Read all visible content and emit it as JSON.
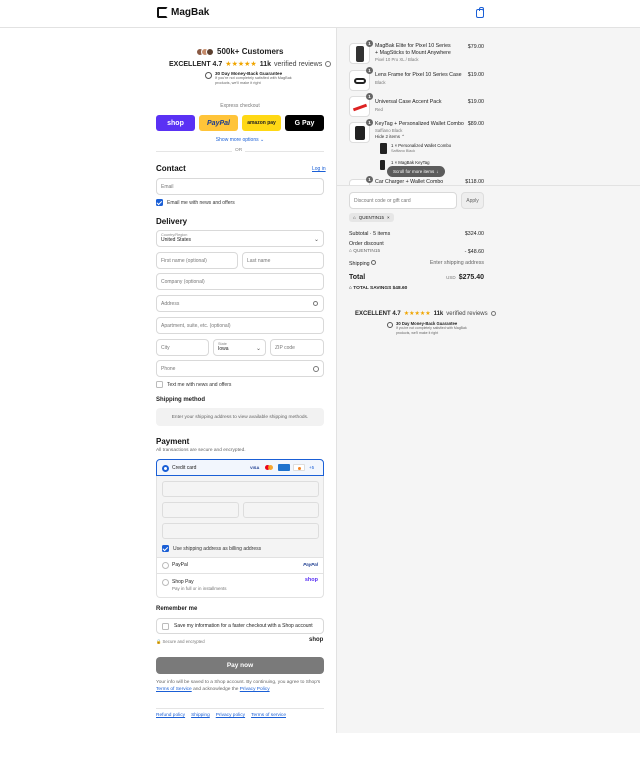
{
  "header": {
    "brand": "MagBak"
  },
  "trust": {
    "customers": "500k+ Customers",
    "excellent": "EXCELLENT 4.7",
    "stars": "★★★★★",
    "reviews_count": "11k",
    "reviews_label": "verified reviews",
    "guarantee_title": "30 Day Money-Back Guarantee",
    "guarantee_text": "If you're not completely satisfied with MagBak products, we'll make it right"
  },
  "express": {
    "label": "Express checkout",
    "shop": "shop",
    "paypal": "PayPal",
    "amazon": "amazon pay",
    "gpay": "G Pay",
    "show_more": "Show more options",
    "or": "OR"
  },
  "contact": {
    "title": "Contact",
    "login": "Log in",
    "email_placeholder": "Email",
    "newsletter": "Email me with news and offers"
  },
  "delivery": {
    "title": "Delivery",
    "country_label": "Country/Region",
    "country": "United States",
    "first": "First name (optional)",
    "last": "Last name",
    "company": "Company (optional)",
    "address": "Address",
    "apt": "Apartment, suite, etc. (optional)",
    "city": "City",
    "state_label": "State",
    "state": "Iowa",
    "zip": "ZIP code",
    "phone": "Phone",
    "text_offers": "Text me with news and offers"
  },
  "shipping": {
    "title": "Shipping method",
    "info": "Enter your shipping address to view available shipping methods."
  },
  "payment": {
    "title": "Payment",
    "subtitle": "All transactions are secure and encrypted.",
    "credit": "Credit card",
    "more_cards": "+5",
    "billing": "Use shipping address as billing address",
    "paypal": "PayPal",
    "paypal_logo": "PayPal",
    "shop_pay": "Shop Pay",
    "shop_pay_sub": "Pay in full or in installments",
    "shop_pay_logo": "shop"
  },
  "remember": {
    "title": "Remember me",
    "save": "Save my information for a faster checkout with a Shop account",
    "secure": "Secure and encrypted",
    "shop_logo": "shop"
  },
  "pay_button": "Pay now",
  "legal": {
    "text": "Your info will be saved to a Shop account. By continuing, you agree to Shop's",
    "tos": "Terms of Service",
    "and": "and acknowledge the",
    "privacy": "Privacy Policy"
  },
  "footer": {
    "refund": "Refund policy",
    "shipping": "Shipping",
    "privacy": "Privacy policy",
    "terms": "Terms of service"
  },
  "cart": {
    "items": [
      {
        "qty": "1",
        "name": "MagBak Elite for Pixel 10 Series + MagSticks to Mount Anywhere",
        "sub": "Pixel 10 Pro XL / Black",
        "price": "$79.00"
      },
      {
        "qty": "1",
        "name": "Lens Frame for Pixel 10 Series Case",
        "sub": "Black",
        "price": "$19.00"
      },
      {
        "qty": "1",
        "name": "Universal Case Accent Pack",
        "sub": "Red",
        "price": "$19.00"
      },
      {
        "qty": "1",
        "name": "KeyTag + Personalized Wallet Combo",
        "sub": "Saffiano Black",
        "price": "$89.00"
      },
      {
        "qty": "1",
        "name": "Car Charger + Wallet Combo",
        "sub": "",
        "price": "$118.00"
      }
    ],
    "hide_items": "Hide 2 items",
    "sub_items": [
      {
        "name": "1 × Personalized Wallet Combo",
        "sub": "Saffiano Black"
      },
      {
        "name": "1 × MagBak KeyTag",
        "sub": ""
      }
    ],
    "scroll_hint": "Scroll for more items",
    "discount_placeholder": "Discount code or gift card",
    "apply": "Apply",
    "code": "QUENTIN15",
    "subtotal_label": "Subtotal · 5 items",
    "subtotal": "$324.00",
    "order_discount": "Order discount",
    "discount_code": "QUENTIN15",
    "discount_value": "- $48.60",
    "shipping_label": "Shipping",
    "shipping_value": "Enter shipping address",
    "total_label": "Total",
    "currency": "USD",
    "total": "$275.40",
    "savings": "TOTAL SAVINGS $48.60",
    "excellent": "EXCELLENT 4.7",
    "stars": "★★★★★",
    "reviews_count": "11k",
    "reviews_label": "verified reviews",
    "guarantee_title": "30 Day Money-Back Guarantee",
    "guarantee_text": "If you're not completely satisfied with MagBak products, we'll make it right"
  },
  "colors": {
    "shop": "#5a31f4",
    "paypal": "#ffc439",
    "amazon": "#ffd814",
    "gpay": "#000000",
    "accent": "#1a5fd6",
    "pay_button": "#7a7a7a"
  }
}
